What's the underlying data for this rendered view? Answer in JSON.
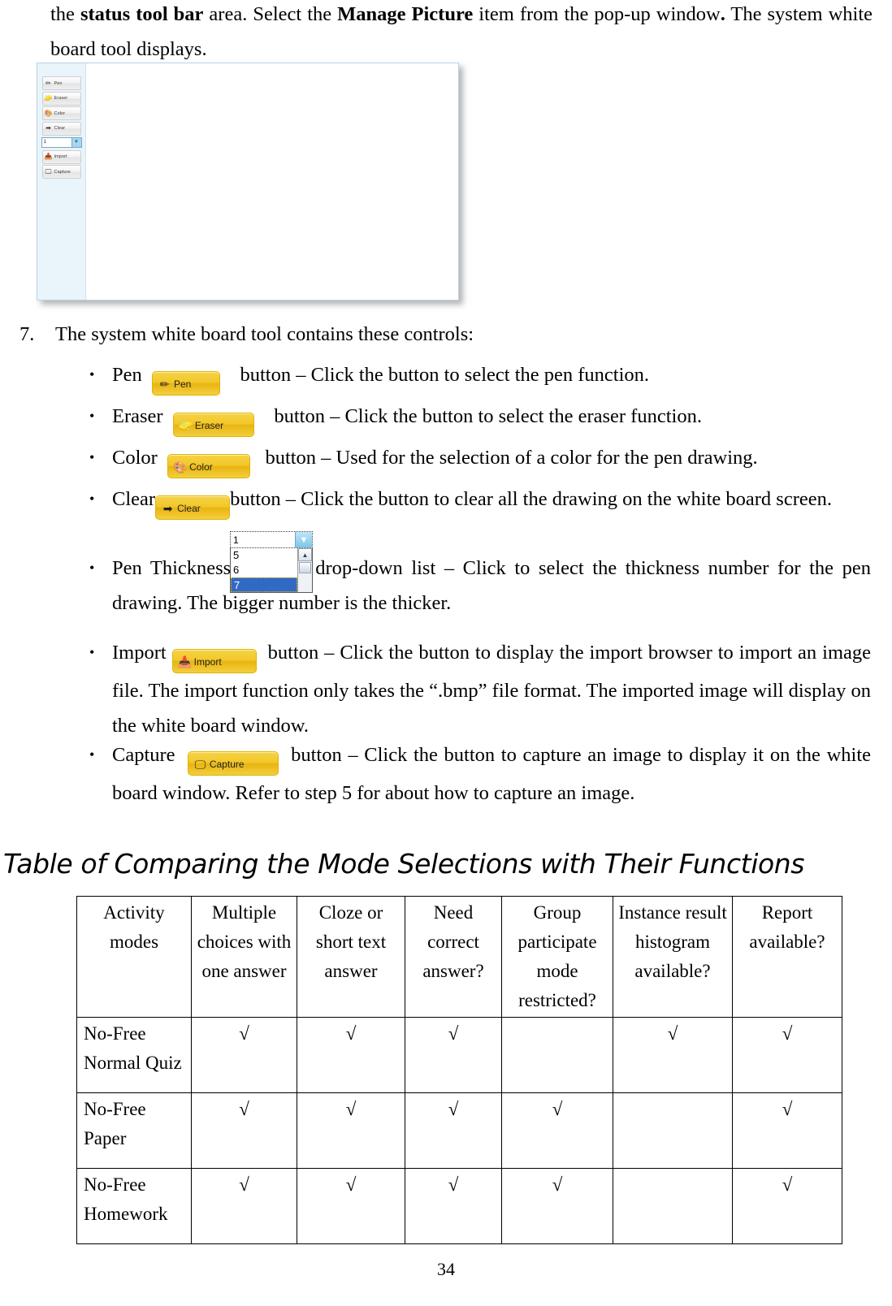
{
  "document": {
    "page_number": "34",
    "intro_paragraph_parts": {
      "p1": "the ",
      "b1": "status tool bar",
      "p2": " area. Select the ",
      "b2": "Manage Picture",
      "p3": " item from the pop-up window",
      "b3": ".",
      "p4": " The system white board tool displays."
    },
    "step": {
      "number": "7.",
      "text": "The system white board tool contains these controls:"
    },
    "section_heading": "Table of Comparing the Mode Selections with Their Functions"
  },
  "whiteboard_screenshot": {
    "toolbar_buttons": [
      {
        "label": "Pen",
        "icon": "pen-icon",
        "glyph": "✏"
      },
      {
        "label": "Eraser",
        "icon": "eraser-icon",
        "glyph": "🧽"
      },
      {
        "label": "Color",
        "icon": "color-palette-icon",
        "glyph": "🎨"
      },
      {
        "label": "Clear",
        "icon": "clear-arrow-icon",
        "glyph": "➡"
      }
    ],
    "thickness_combo": {
      "value": "1",
      "arrow_icon": "chevron-down-icon",
      "arrow_glyph": "▼"
    },
    "toolbar_buttons_lower": [
      {
        "label": "Import",
        "icon": "import-icon",
        "glyph": "📥"
      },
      {
        "label": "Capture",
        "icon": "capture-icon",
        "glyph": "🖵"
      }
    ]
  },
  "controls": [
    {
      "name": "Pen",
      "button": {
        "label": "Pen",
        "icon": "pen-icon",
        "glyph": "✏"
      },
      "pre": "Pen",
      "post": "button – Click the button to select the pen function."
    },
    {
      "name": "Eraser",
      "button": {
        "label": "Eraser",
        "icon": "eraser-icon",
        "glyph": "🧽"
      },
      "pre": "Eraser",
      "post": "button – Click the button to select the eraser function."
    },
    {
      "name": "Color",
      "button": {
        "label": "Color",
        "icon": "color-palette-icon",
        "glyph": "🎨"
      },
      "pre": "Color",
      "post": "button – Used for the selection of a color for the pen drawing."
    },
    {
      "name": "Clear",
      "button": {
        "label": "Clear",
        "icon": "clear-arrow-icon",
        "glyph": "➡"
      },
      "pre": "Clear",
      "post": "button – Click the button to clear all the drawing on the white board screen."
    },
    {
      "name": "Pen Thickness",
      "pre": "Pen Thickness",
      "post": "drop-down list – Click to select the thickness number for the pen drawing. The bigger number is the thicker."
    },
    {
      "name": "Import",
      "button": {
        "label": "Import",
        "icon": "import-icon",
        "glyph": "📥"
      },
      "pre": "Import",
      "post": "button – Click the button to display the import browser to import an image file. The import function only takes the “.bmp” file format. The imported image will display on the white board window."
    },
    {
      "name": "Capture",
      "button": {
        "label": "Capture",
        "icon": "capture-icon",
        "glyph": "🖵"
      },
      "pre": "Capture",
      "post": "button – Click the button to capture an image to display it on the white board window. Refer to step 5 for about how to capture an image."
    }
  ],
  "thickness_dropdown": {
    "value": "1",
    "arrow_icon": "chevron-down-icon",
    "arrow_glyph": "▼",
    "options": [
      "5",
      "6",
      "7"
    ],
    "selected_option": "7",
    "scroll_up_glyph": "▲"
  },
  "mode_table": {
    "headers": [
      "Activity modes",
      "Multiple choices with one answer",
      "Cloze or short text answer",
      "Need correct answer?",
      "Group participate mode restricted?",
      "Instance result histogram available?",
      "Report available?"
    ],
    "check_mark": "√",
    "rows": [
      {
        "mode": "No-Free Normal Quiz",
        "cells": [
          "√",
          "√",
          "√",
          "",
          "√",
          "√"
        ]
      },
      {
        "mode": "No-Free Paper",
        "cells": [
          "√",
          "√",
          "√",
          "√",
          "",
          "√"
        ]
      },
      {
        "mode": "No-Free Homework",
        "cells": [
          "√",
          "√",
          "√",
          "√",
          "",
          "√"
        ]
      }
    ]
  }
}
